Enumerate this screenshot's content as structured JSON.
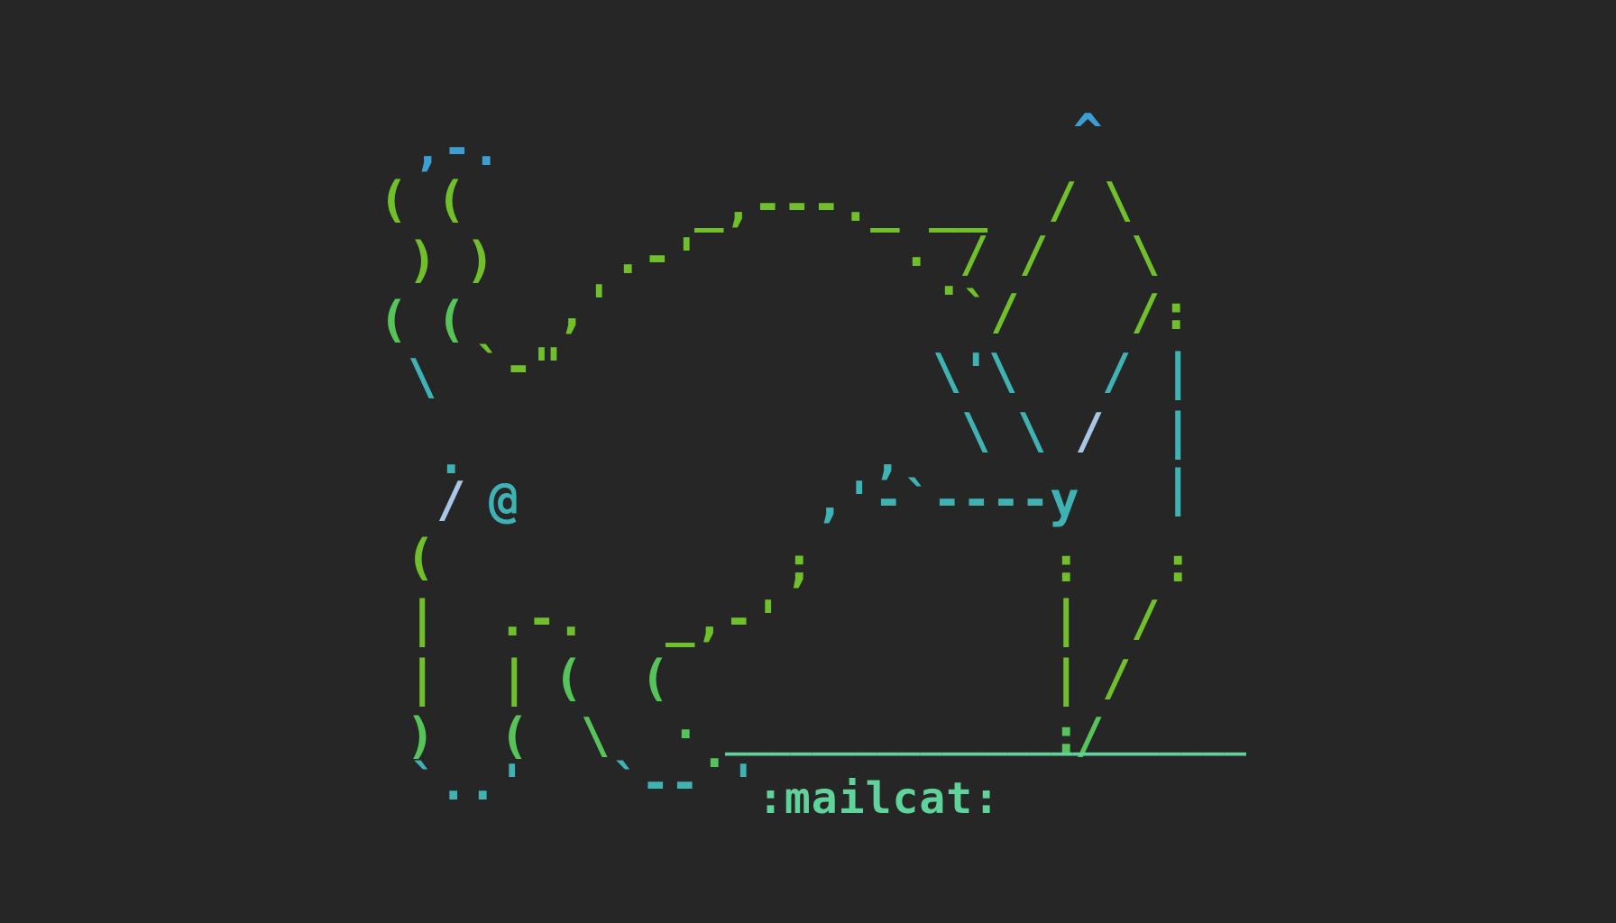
{
  "art": {
    "caption": ":mailcat:",
    "colors": {
      "background": "#262626",
      "blue": "#3b9fd1",
      "teal": "#3fb3b3",
      "green": "#6fc02a",
      "lime": "#57c459",
      "mint": "#5fd39a",
      "pale": "#a8c6e6"
    },
    "glyphs": {
      "tail_tip": ",-.",
      "paren_open": "(",
      "paren_close": ")",
      "backslash": "\\",
      "slash": "/",
      "pipe": "|",
      "caret": "^",
      "at": "@",
      "dot": ".",
      "comma": ",",
      "semicolon": ";",
      "colon": ":",
      "apostrophe": "'",
      "backtick": "`",
      "y": "y",
      "quote_tail": "`-\"",
      "back_top": "_,---._ __",
      "back_left": ".-'",
      "belly_dash": ",'-`----y",
      "leg_join": "_,-'",
      "paw_top": ".-.",
      "paw_bottom": "`-- '",
      "foot": "`..'",
      "floor": "________________________"
    }
  }
}
